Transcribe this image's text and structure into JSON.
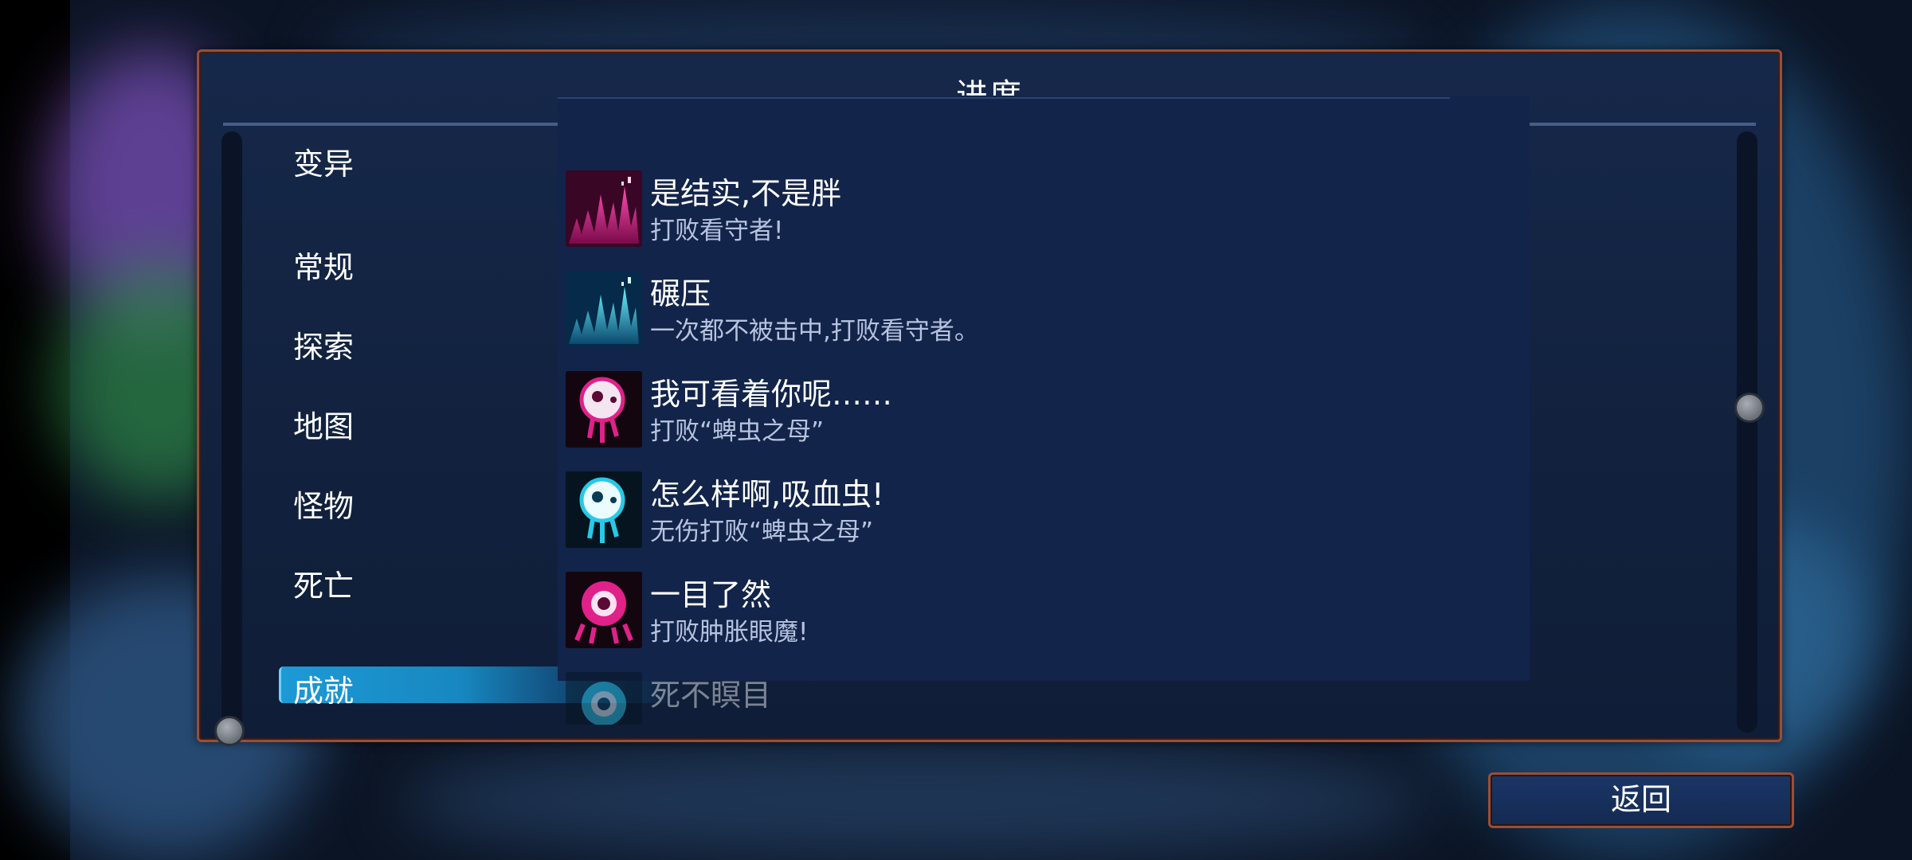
{
  "panel": {
    "title": "进度"
  },
  "categories": [
    {
      "label": "变异"
    },
    {
      "label": "常规"
    },
    {
      "label": "探索"
    },
    {
      "label": "地图"
    },
    {
      "label": "怪物"
    },
    {
      "label": "死亡"
    },
    {
      "label": "成就",
      "selected": true
    }
  ],
  "achievements": [
    {
      "name": "是结实,不是胖",
      "desc": "打败看守者!",
      "icon": "pink-spikes-icon",
      "color": "#e0218a"
    },
    {
      "name": "碾压",
      "desc": "一次都不被击中,打败看守者。",
      "icon": "cyan-spikes-icon",
      "color": "#28c8e6"
    },
    {
      "name": "我可看着你呢……",
      "desc": "打败“蜱虫之母”",
      "icon": "pink-eye-creature-icon",
      "color": "#e0218a"
    },
    {
      "name": "怎么样啊,吸血虫!",
      "desc": "无伤打败“蜱虫之母”",
      "icon": "cyan-eye-creature-icon",
      "color": "#28c8e6"
    },
    {
      "name": "一目了然",
      "desc": "打败肿胀眼魔!",
      "icon": "pink-eye-monster-icon",
      "color": "#e0218a"
    },
    {
      "name": "死不瞑目",
      "desc": "",
      "icon": "cyan-eye-monster-icon",
      "color": "#28c8e6"
    }
  ],
  "back_button": {
    "label": "返回"
  }
}
